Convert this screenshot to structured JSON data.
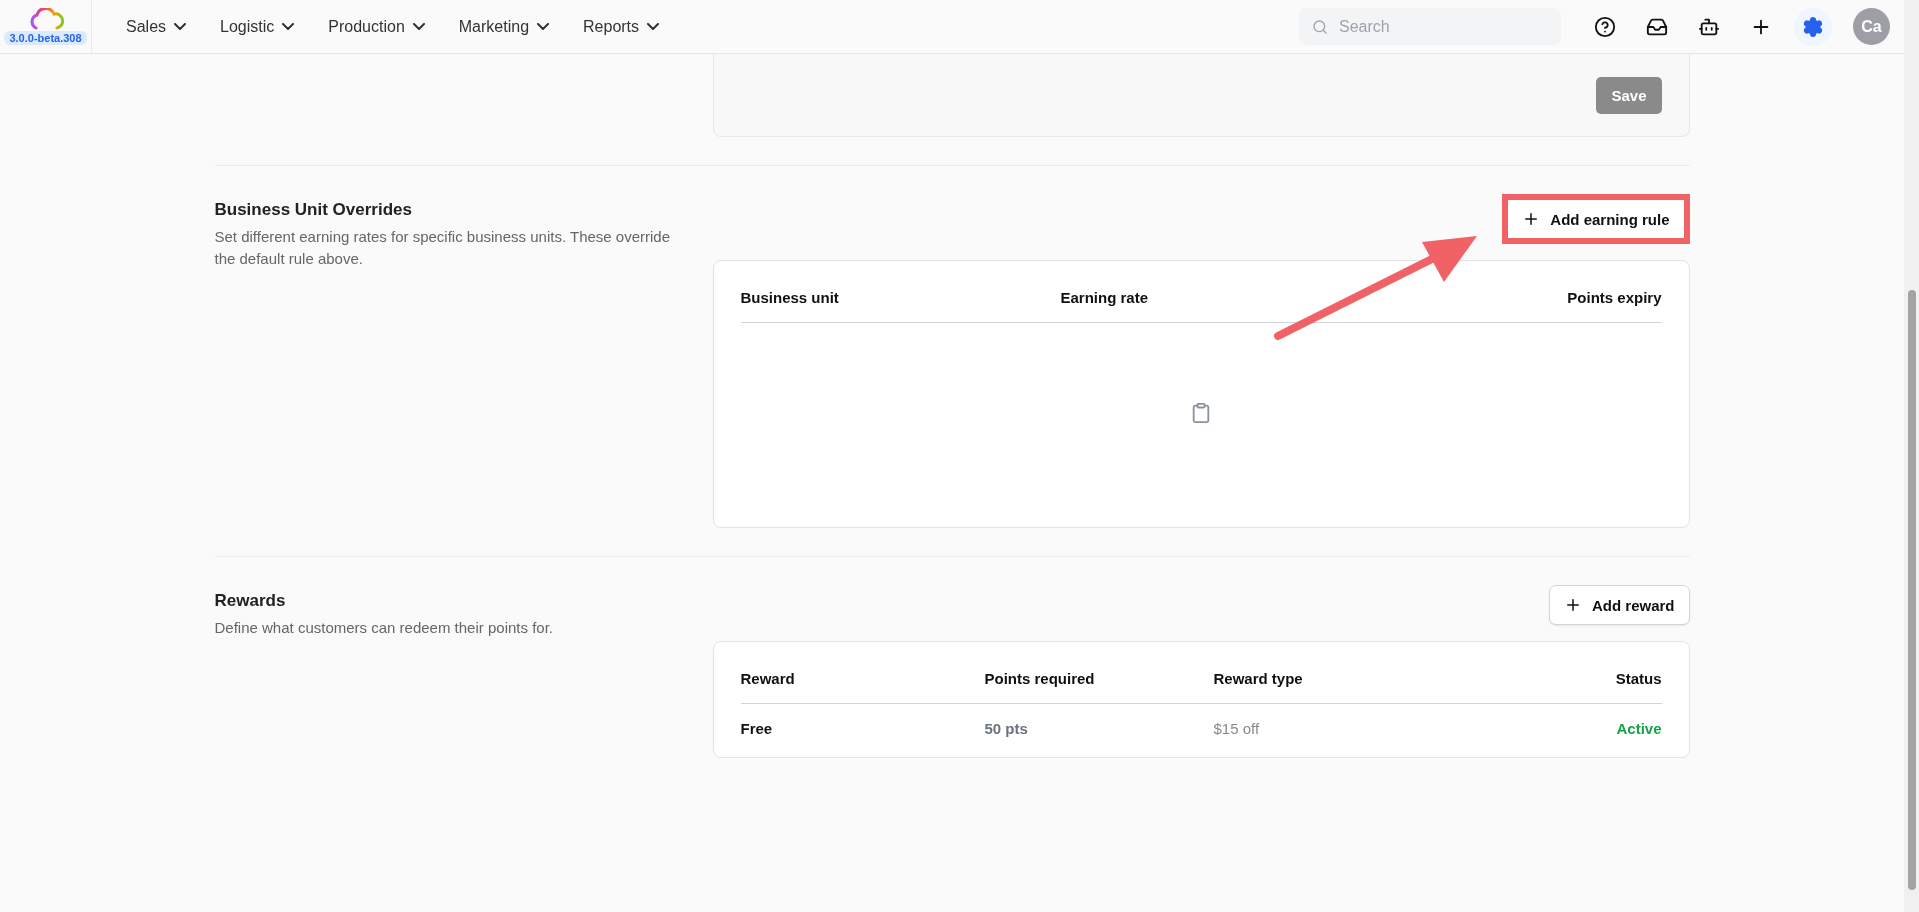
{
  "header": {
    "version": "3.0.0-beta.308",
    "nav": [
      {
        "label": "Sales"
      },
      {
        "label": "Logistic"
      },
      {
        "label": "Production"
      },
      {
        "label": "Marketing"
      },
      {
        "label": "Reports"
      }
    ],
    "search": {
      "placeholder": "Search"
    },
    "tools": [
      {
        "kind": "help",
        "selected": false
      },
      {
        "kind": "inbox",
        "selected": false
      },
      {
        "kind": "bot",
        "selected": false
      },
      {
        "kind": "add",
        "selected": false
      },
      {
        "kind": "settings",
        "selected": true
      }
    ],
    "avatar": {
      "initials": "Ca"
    }
  },
  "top_card": {
    "save_button": "Save"
  },
  "sections": [
    {
      "title": "Business Unit Overrides",
      "description": "Set different earning rates for specific business units. These override the default rule above.",
      "action": {
        "label": "Add earning rule",
        "highlighted": true
      },
      "table": {
        "columns": [
          "Business unit",
          "Earning rate",
          "Points expiry"
        ]
      }
    },
    {
      "title": "Rewards",
      "description": "Define what customers can redeem their points for.",
      "action": {
        "label": "Add reward",
        "highlighted": false
      },
      "table": {
        "columns": [
          "Reward",
          "Points required",
          "Reward type",
          "Status"
        ],
        "rows": [
          {
            "cells": [
              "Free",
              "50 pts",
              "$15 off"
            ],
            "status": {
              "text": "Active",
              "kind": "active"
            }
          }
        ]
      }
    }
  ]
}
